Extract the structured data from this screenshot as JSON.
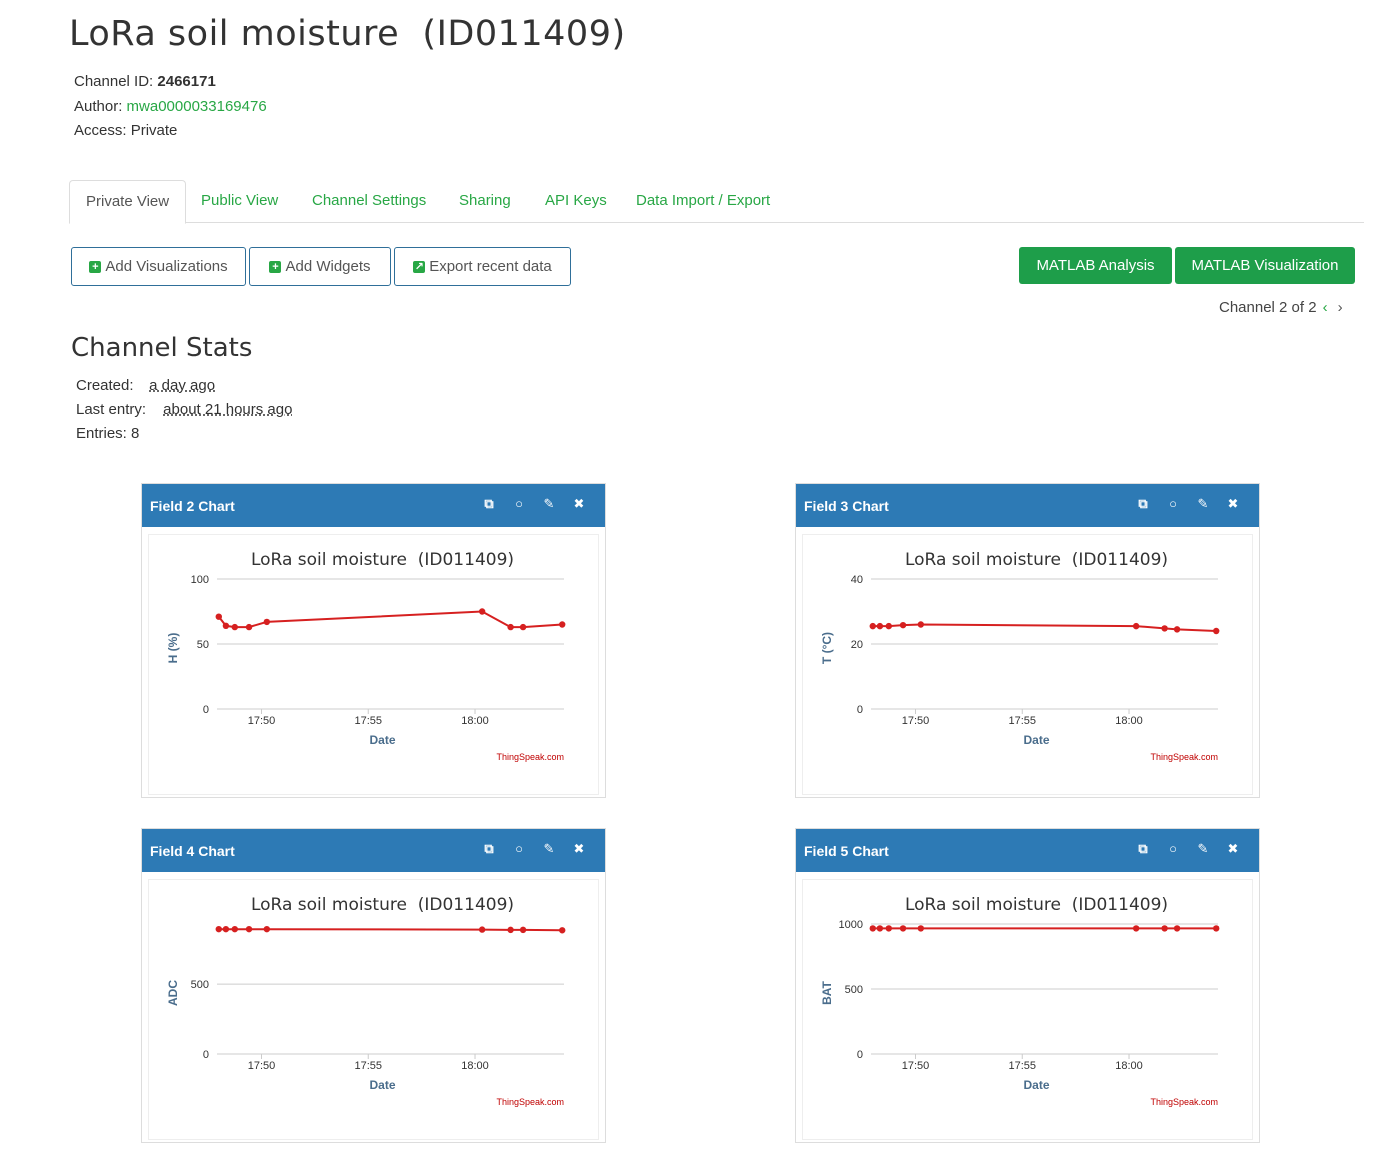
{
  "header": {
    "title": "LoRa soil moisture  (ID011409)",
    "channel_id_label": "Channel ID:",
    "channel_id": "2466171",
    "author_label": "Author:",
    "author": "mwa0000033169476",
    "access_label": "Access:",
    "access": "Private"
  },
  "tabs": [
    "Private View",
    "Public View",
    "Channel Settings",
    "Sharing",
    "API Keys",
    "Data Import / Export"
  ],
  "toolbar": {
    "add_visualizations": "Add Visualizations",
    "add_widgets": "Add Widgets",
    "export_recent": "Export recent data",
    "matlab_analysis": "MATLAB Analysis",
    "matlab_visualization": "MATLAB Visualization"
  },
  "pager": {
    "text": "Channel 2 of 2",
    "prev": "‹",
    "next": "›"
  },
  "stats": {
    "title": "Channel Stats",
    "created_label": "Created:",
    "created": "a day ago",
    "last_entry_label": "Last entry:",
    "last_entry": "about 21 hours ago",
    "entries_label": "Entries:",
    "entries": "8"
  },
  "colors": {
    "brand_green": "#28a745",
    "panel_blue": "#2d7ab5",
    "series_red": "#d62020"
  },
  "panel_icons": [
    "external-link-icon",
    "comment-icon",
    "pencil-icon",
    "close-icon"
  ],
  "chart_data": [
    {
      "type": "line",
      "panel_title": "Field 2 Chart",
      "title": "LoRa soil moisture  (ID011409)",
      "xlabel": "Date",
      "ylabel": "H (%)",
      "credit": "ThingSpeak.com",
      "x_ticks": [
        "17:50",
        "17:55",
        "18:00"
      ],
      "xlim": [
        "17:47:55",
        "18:04:10"
      ],
      "y_ticks": [
        0,
        50,
        100
      ],
      "ylim": [
        0,
        100
      ],
      "x": [
        "17:48:00",
        "17:48:20",
        "17:48:45",
        "17:49:25",
        "17:50:15",
        "18:00:20",
        "18:01:40",
        "18:02:15",
        "18:04:05"
      ],
      "values": [
        71,
        64,
        63,
        63,
        67,
        75,
        63,
        63,
        65
      ]
    },
    {
      "type": "line",
      "panel_title": "Field 3 Chart",
      "title": "LoRa soil moisture  (ID011409)",
      "xlabel": "Date",
      "ylabel": "T (°C)",
      "credit": "ThingSpeak.com",
      "x_ticks": [
        "17:50",
        "17:55",
        "18:00"
      ],
      "xlim": [
        "17:47:55",
        "18:04:10"
      ],
      "y_ticks": [
        0,
        20,
        40
      ],
      "ylim": [
        0,
        40
      ],
      "x": [
        "17:48:00",
        "17:48:20",
        "17:48:45",
        "17:49:25",
        "17:50:15",
        "18:00:20",
        "18:01:40",
        "18:02:15",
        "18:04:05"
      ],
      "values": [
        25.5,
        25.5,
        25.5,
        25.8,
        26,
        25.5,
        24.8,
        24.5,
        24
      ]
    },
    {
      "type": "line",
      "panel_title": "Field 4 Chart",
      "title": "LoRa soil moisture  (ID011409)",
      "xlabel": "Date",
      "ylabel": "ADC",
      "credit": "ThingSpeak.com",
      "x_ticks": [
        "17:50",
        "17:55",
        "18:00"
      ],
      "xlim": [
        "17:47:55",
        "18:04:10"
      ],
      "y_ticks": [
        0,
        500
      ],
      "ylim": [
        0,
        930
      ],
      "x": [
        "17:48:00",
        "17:48:20",
        "17:48:45",
        "17:49:25",
        "17:50:15",
        "18:00:20",
        "18:01:40",
        "18:02:15",
        "18:04:05"
      ],
      "values": [
        893,
        893,
        893,
        893,
        893,
        890,
        888,
        888,
        885
      ]
    },
    {
      "type": "line",
      "panel_title": "Field 5 Chart",
      "title": "LoRa soil moisture  (ID011409)",
      "xlabel": "Date",
      "ylabel": "BAT",
      "credit": "ThingSpeak.com",
      "x_ticks": [
        "17:50",
        "17:55",
        "18:00"
      ],
      "xlim": [
        "17:47:55",
        "18:04:10"
      ],
      "y_ticks": [
        0,
        500,
        1000
      ],
      "ylim": [
        0,
        1000
      ],
      "x": [
        "17:48:00",
        "17:48:20",
        "17:48:45",
        "17:49:25",
        "17:50:15",
        "18:00:20",
        "18:01:40",
        "18:02:15",
        "18:04:05"
      ],
      "values": [
        966,
        966,
        966,
        966,
        966,
        966,
        966,
        966,
        966
      ]
    }
  ]
}
